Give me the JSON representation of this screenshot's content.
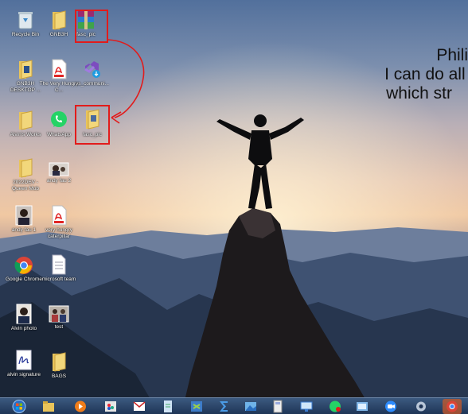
{
  "desktop": {
    "verse": {
      "line1": "Phili",
      "line2": "I can do all th",
      "line3": "which str"
    },
    "icons": [
      {
        "label": "Recycle Bin",
        "icon": "recycle-bin-icon"
      },
      {
        "label": "GNB3H",
        "icon": "folder-icon"
      },
      {
        "label": "fasc_pic",
        "icon": "winrar-archive-icon"
      },
      {
        "label": "GNB3H DESKTOP ...",
        "icon": "folder-icon"
      },
      {
        "label": "The Very Hungry C...",
        "icon": "pdf-icon"
      },
      {
        "label": "vs_communi...",
        "icon": "visual-studio-installer-icon"
      },
      {
        "label": "Alvin's Works",
        "icon": "folder-icon"
      },
      {
        "label": "WhatsApp",
        "icon": "whatsapp-icon"
      },
      {
        "label": "fasc_pic",
        "icon": "folder-icon"
      },
      {
        "label": "2022DEV - Queen Mob",
        "icon": "folder-icon"
      },
      {
        "label": "andy fau 2",
        "icon": "photo-icon"
      },
      {
        "label": "andy fau 1",
        "icon": "photo-icon"
      },
      {
        "label": "very hungry caterpillar",
        "icon": "pdf-icon"
      },
      {
        "label": "Google Chrome",
        "icon": "chrome-icon"
      },
      {
        "label": "microsoft team",
        "icon": "text-file-icon"
      },
      {
        "label": "Alvin photo",
        "icon": "photo-icon"
      },
      {
        "label": "test",
        "icon": "photo-icon"
      },
      {
        "label": "alvin signature",
        "icon": "signature-image-icon"
      },
      {
        "label": "BAGS",
        "icon": "folder-icon"
      }
    ]
  },
  "taskbar": {
    "items": [
      "start-orb-icon",
      "file-explorer-icon",
      "media-player-icon",
      "paint-icon",
      "outlook-icon",
      "notepad-icon",
      "visual-studio-icon",
      "sigma-icon",
      "photos-icon",
      "calculator-icon",
      "remote-desktop-icon",
      "whatsapp-icon",
      "ie-icon",
      "zoom-icon",
      "settings-icon",
      "chrome-icon"
    ]
  },
  "colors": {
    "selection": "#e21b1b",
    "taskbar": "#1d3354"
  }
}
